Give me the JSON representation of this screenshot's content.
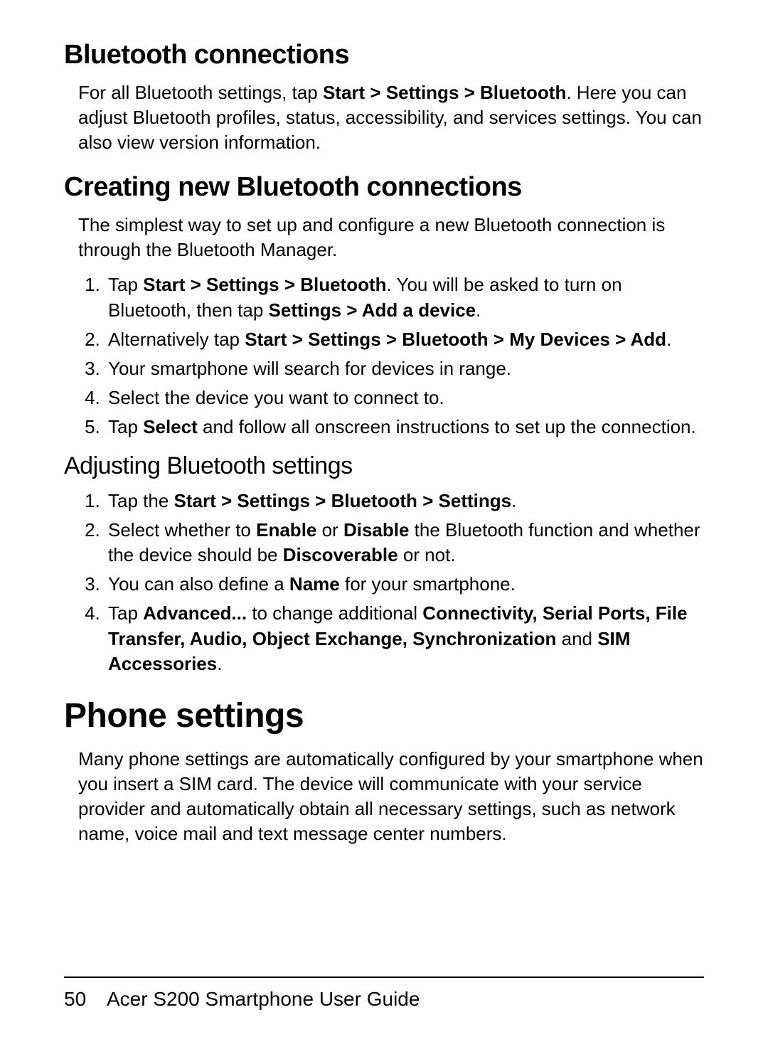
{
  "section1": {
    "title": "Bluetooth connections",
    "para_pre": "For all Bluetooth settings, tap ",
    "bold1": "Start > Settings > Bluetooth",
    "para_post": ". Here you can adjust Bluetooth profiles, status, accessibility, and services settings. You can also view version information."
  },
  "section2": {
    "title": "Creating new Bluetooth connections",
    "para": "The simplest way to set up and configure a new Bluetooth connection is through the Bluetooth Manager.",
    "steps": {
      "s1_a": "Tap ",
      "s1_b": "Start > Settings > Bluetooth",
      "s1_c": ". You will be asked to turn on Bluetooth, then tap ",
      "s1_d": "Settings > Add a device",
      "s1_e": ".",
      "s2_a": "Alternatively tap ",
      "s2_b": "Start > Settings > Bluetooth > My Devices > Add",
      "s2_c": ".",
      "s3": "Your smartphone will search for devices in range.",
      "s4": "Select the device you want to connect to.",
      "s5_a": "Tap ",
      "s5_b": "Select",
      "s5_c": " and follow all onscreen instructions to set up the connection."
    }
  },
  "section3": {
    "title": "Adjusting Bluetooth settings",
    "steps": {
      "s1_a": "Tap the ",
      "s1_b": "Start > Settings > Bluetooth > Settings",
      "s1_c": ".",
      "s2_a": "Select whether to ",
      "s2_b": "Enable",
      "s2_c": " or ",
      "s2_d": "Disable",
      "s2_e": " the Bluetooth function and whether the device should be ",
      "s2_f": "Discoverable",
      "s2_g": " or not.",
      "s3_a": "You can also define a ",
      "s3_b": "Name",
      "s3_c": " for your smartphone.",
      "s4_a": "Tap ",
      "s4_b": "Advanced...",
      "s4_c": " to change additional ",
      "s4_d": "Connectivity, Serial Ports, File Transfer, Audio, Object Exchange, Synchroniza­tion",
      "s4_e": " and ",
      "s4_f": "SIM Accessories",
      "s4_g": "."
    }
  },
  "section4": {
    "title": "Phone settings",
    "para": "Many phone settings are automatically configured by your smartphone when you insert a SIM card. The device will com­municate with your service provider and automatically obtain all necessary settings, such as network name, voice mail and text message center numbers."
  },
  "footer": {
    "pagenum": "50",
    "title": "Acer S200 Smartphone User Guide"
  }
}
